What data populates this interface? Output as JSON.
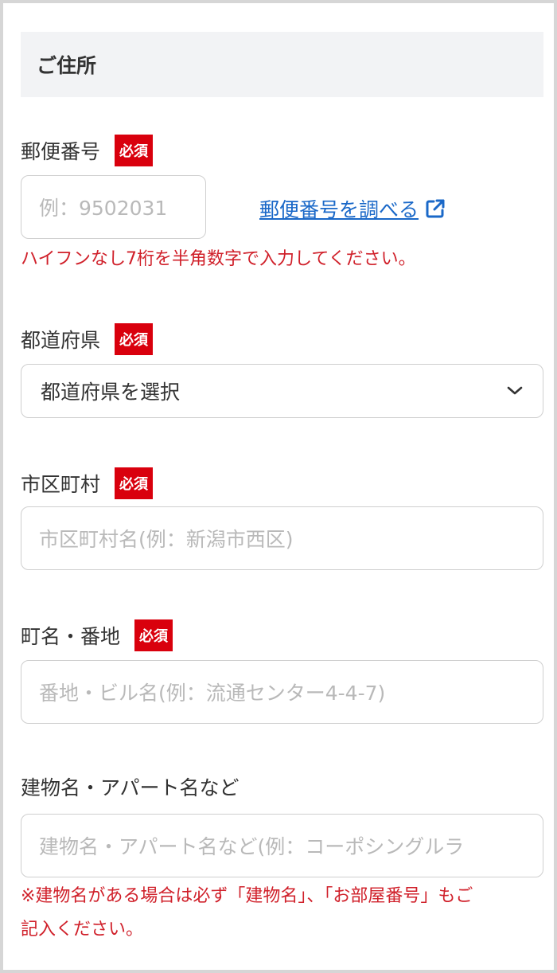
{
  "section": {
    "title": "ご住所"
  },
  "required_badge": "必須",
  "postal": {
    "label": "郵便番号",
    "placeholder": "例：9502031",
    "lookup_link": "郵便番号を調べる",
    "hint": "ハイフンなし7桁を半角数字で入力してください。"
  },
  "prefecture": {
    "label": "都道府県",
    "selected": "都道府県を選択"
  },
  "city": {
    "label": "市区町村",
    "placeholder": "市区町村名(例：新潟市西区)"
  },
  "street": {
    "label": "町名・番地",
    "placeholder": "番地・ビル名(例：流通センター4-4-7)"
  },
  "building": {
    "label": "建物名・アパート名など",
    "placeholder": "建物名・アパート名など(例：コーポシングルラ",
    "note_line1": "※建物名がある場合は必ず「建物名」、「お部屋番号」もご",
    "note_line2": "記入ください。"
  },
  "colors": {
    "required_badge": "#d9000d",
    "link": "#1a68c8",
    "error": "#d0202a"
  },
  "icons": {
    "external_link": "external-link-icon",
    "dropdown": "chevron-down-icon"
  }
}
